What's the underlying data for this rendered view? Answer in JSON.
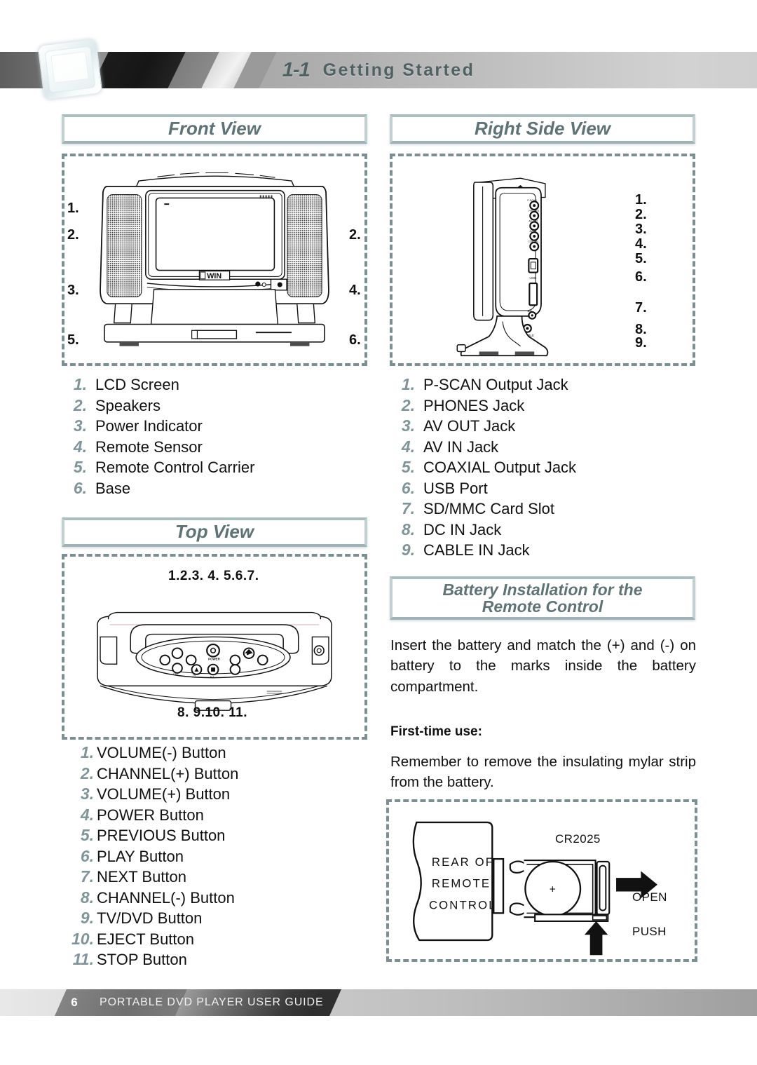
{
  "header": {
    "section_number": "1-1",
    "title": "Getting Started",
    "icon": "glass-cube-icon"
  },
  "colors": {
    "accent": "#5e7376",
    "number_accent": "#7e9599",
    "dashed_border": "#7b9093",
    "box_border": "#aabdbf"
  },
  "sections": {
    "front_view": {
      "title": "Front View",
      "callouts_left": [
        "1.",
        "2.",
        "3.",
        "5."
      ],
      "callouts_right": [
        "2.",
        "4.",
        "6."
      ],
      "screen_badge": "WIN",
      "items": [
        {
          "n": "1.",
          "label": "LCD Screen"
        },
        {
          "n": "2.",
          "label": "Speakers"
        },
        {
          "n": "3.",
          "label": "Power Indicator"
        },
        {
          "n": "4.",
          "label": "Remote Sensor"
        },
        {
          "n": "5.",
          "label": "Remote Control Carrier"
        },
        {
          "n": "6.",
          "label": "Base"
        }
      ]
    },
    "right_side_view": {
      "title": "Right Side View",
      "callouts": [
        "1.",
        "2.",
        "3.",
        "4.",
        "5.",
        "6.",
        "7.",
        "8.",
        "9."
      ],
      "items": [
        {
          "n": "1.",
          "label": "P-SCAN Output Jack"
        },
        {
          "n": "2.",
          "label": "PHONES Jack"
        },
        {
          "n": "3.",
          "label": "AV OUT Jack"
        },
        {
          "n": "4.",
          "label": "AV IN Jack"
        },
        {
          "n": "5.",
          "label": "COAXIAL Output Jack"
        },
        {
          "n": "6.",
          "label": "USB Port"
        },
        {
          "n": "7.",
          "label": "SD/MMC Card Slot"
        },
        {
          "n": "8.",
          "label": "DC IN Jack"
        },
        {
          "n": "9.",
          "label": "CABLE IN Jack"
        }
      ]
    },
    "top_view": {
      "title": "Top View",
      "callouts_top": "1.2.3.  4.  5.6.7.",
      "callouts_bottom": "8.   9.10. 11.",
      "items": [
        {
          "n": "1.",
          "label": "VOLUME(-) Button"
        },
        {
          "n": "2.",
          "label": "CHANNEL(+) Button"
        },
        {
          "n": "3.",
          "label": "VOLUME(+) Button"
        },
        {
          "n": "4.",
          "label": "POWER Button"
        },
        {
          "n": "5.",
          "label": "PREVIOUS Button"
        },
        {
          "n": "6.",
          "label": "PLAY Button"
        },
        {
          "n": "7.",
          "label": "NEXT Button"
        },
        {
          "n": "8.",
          "label": "CHANNEL(-) Button"
        },
        {
          "n": "9.",
          "label": "TV/DVD Button"
        },
        {
          "n": "10.",
          "label": "EJECT Button"
        },
        {
          "n": "11.",
          "label": "STOP Button"
        }
      ]
    },
    "battery": {
      "title_line1": "Battery Installation for the",
      "title_line2": "Remote Control",
      "paragraph": "Insert the battery and match the (+) and (-) on battery to the marks inside the battery compartment.",
      "first_time_heading": "First-time use:",
      "first_time_text": "Remember to remove the insulating mylar strip from the battery.",
      "diagram": {
        "remote_label_line1": "REAR OF",
        "remote_label_line2": "REMOTE",
        "remote_label_line3": "CONTROL",
        "battery_model": "CR2025",
        "battery_polarity": "+",
        "open_label": "OPEN",
        "push_label": "PUSH"
      }
    }
  },
  "footer": {
    "page_number": "6",
    "guide_title": "PORTABLE DVD PLAYER USER GUIDE"
  }
}
